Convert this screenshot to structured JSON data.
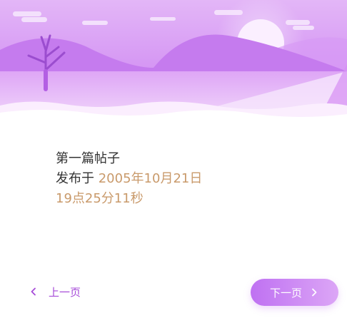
{
  "post": {
    "title": "第一篇帖子",
    "published_prefix": "发布于 ",
    "published_date": "2005年10月21日",
    "published_time": "19点25分11秒"
  },
  "pagination": {
    "prev_label": "上一页",
    "next_label": "下一页"
  },
  "colors": {
    "accent_text": "#c99a6b",
    "primary": "#a64bd8",
    "button_gradient_start": "#bf71f2",
    "button_gradient_end": "#dca6f6"
  },
  "icons": {
    "prev": "chevron-left-icon",
    "next": "chevron-right-icon"
  }
}
